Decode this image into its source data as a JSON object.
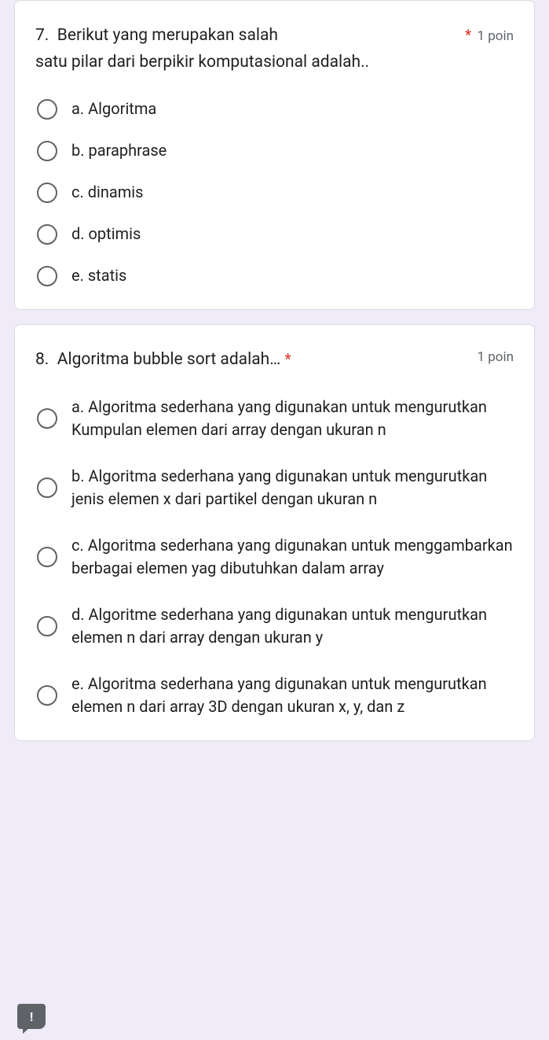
{
  "questions": [
    {
      "number": "7.",
      "text": "Berikut yang merupakan salah satu pilar dari berpikir komputasional adalah..",
      "required": "*",
      "points": "1 poin",
      "options": [
        "a. Algoritma",
        "b. paraphrase",
        "c. dinamis",
        "d. optimis",
        "e. statis"
      ]
    },
    {
      "number": "8.",
      "text": "Algoritma bubble sort adalah…",
      "required": "*",
      "points": "1 poin",
      "options": [
        "a. Algoritma sederhana yang digunakan untuk mengurutkan Kumpulan elemen dari array dengan ukuran n",
        "b. Algoritma sederhana yang digunakan untuk mengurutkan jenis elemen x dari partikel dengan ukuran n",
        "c. Algoritma sederhana yang digunakan untuk menggambarkan berbagai elemen yag dibutuhkan dalam array",
        "d. Algoritme sederhana yang digunakan untuk mengurutkan elemen n dari array dengan ukuran y",
        "e. Algoritma sederhana yang digunakan untuk mengurutkan elemen n dari array 3D dengan ukuran x, y, dan z"
      ]
    }
  ],
  "report_icon_glyph": "!"
}
